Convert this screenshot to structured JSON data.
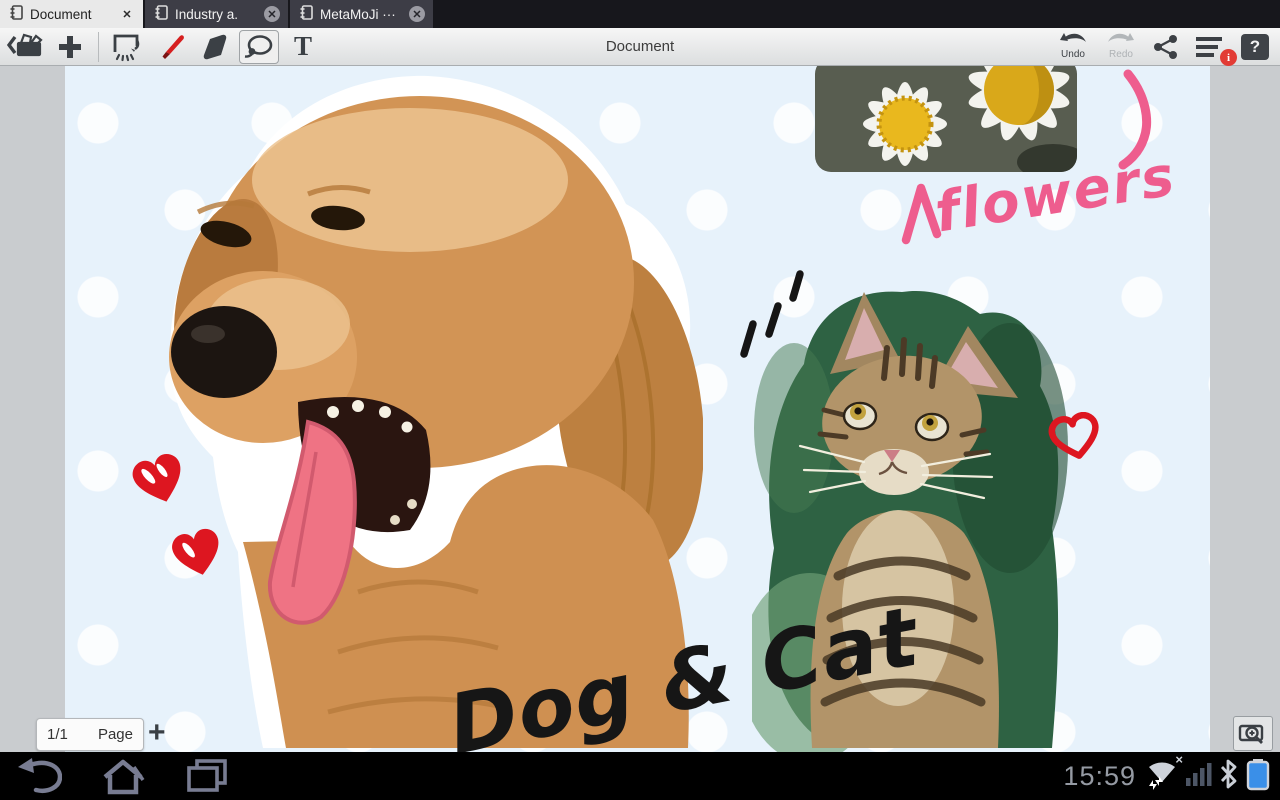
{
  "tabs": [
    {
      "label": "Document",
      "active": true
    },
    {
      "label": "Industry a.",
      "active": false
    },
    {
      "label": "MetaMoJi ···",
      "active": false
    }
  ],
  "toolbar": {
    "title": "Document",
    "undo_label": "Undo",
    "redo_label": "Redo",
    "text_tool_glyph": "T",
    "help_glyph": "?",
    "info_badge_glyph": "i"
  },
  "icons": {
    "close_glyph": "✕",
    "plus_glyph": "+",
    "wifi_x_glyph": "×"
  },
  "canvas": {
    "annotations": {
      "flowers_label": "flowers",
      "dog_cat_label": "Dog & Cat"
    },
    "objects": [
      "daisy-photo",
      "dog-photo",
      "cat-photo",
      "red-hearts",
      "accent-dashes",
      "pink-curve"
    ],
    "colors": {
      "page_blue": "#e7f2fb",
      "ink_black": "#161616",
      "marker_pink": "#ee5d8e",
      "heart_red": "#dd1620"
    }
  },
  "page_controls": {
    "page_indicator": "1/1",
    "page_label": "Page"
  },
  "status_bar": {
    "time": "15:59"
  }
}
